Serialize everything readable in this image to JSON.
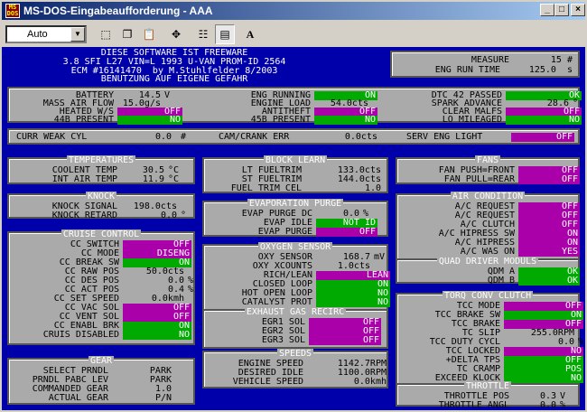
{
  "window": {
    "title": "MS-DOS-Eingabeaufforderung - AAA",
    "icon": "MS-DOS icon"
  },
  "toolbar": {
    "font_size": "Auto",
    "font_button": "A"
  },
  "header": {
    "lines": [
      "DIESE SOFTWARE IST FREEWARE",
      "3.8 SFI L27 VIN=L 1993 U-VAN PROM-ID 2564",
      "ECM #16141470  by M.Stuhlfelder 8/2003",
      "BENUTZUNG AUF EIGENE GEFAHR"
    ],
    "measure_label": "MEASURE",
    "measure_value": "15 #",
    "run_time_label": "ENG RUN TIME",
    "run_time_value": "125.0  s"
  },
  "status_top": {
    "left": [
      {
        "label": "BATTERY",
        "value": "14.5",
        "unit": "V"
      },
      {
        "label": "MASS AIR FLOW",
        "value": "15.0g/s"
      },
      {
        "label": "HEATED W/S",
        "state": "OFF",
        "color": "m"
      },
      {
        "label": "44B PRESENT",
        "state": "NO",
        "color": "g"
      }
    ],
    "mid": [
      {
        "label": "ENG RUNNING",
        "state": "ON",
        "color": "g"
      },
      {
        "label": "ENGINE LOAD",
        "value": "54.0cts"
      },
      {
        "label": "ANTITHEFT",
        "state": "OFF",
        "color": "m"
      },
      {
        "label": "45B PRESENT",
        "state": "NO",
        "color": "g"
      }
    ],
    "right": [
      {
        "label": "DTC 42 PASSED",
        "state": "OK",
        "color": "g"
      },
      {
        "label": "SPARK ADVANCE",
        "value": "28.6",
        "unit": "°"
      },
      {
        "label": "CLEAR MALFS",
        "state": "OFF",
        "color": "m"
      },
      {
        "label": "LO MILEAGED",
        "state": "NO",
        "color": "g"
      }
    ]
  },
  "status_bar": {
    "curr_label": "CURR WEAK CYL",
    "curr_value": "0.0",
    "curr_unit": "#",
    "cam_label": "CAM/CRANK ERR",
    "cam_value": "0.0cts",
    "serv_label": "SERV ENG LIGHT",
    "serv_state": "OFF"
  },
  "temperatures": {
    "title": "TEMPERATURES",
    "rows": [
      {
        "label": "COOLENT TEMP",
        "value": "30.5",
        "unit": "°C"
      },
      {
        "label": "INT AIR TEMP",
        "value": "11.9",
        "unit": "°C"
      }
    ]
  },
  "knock": {
    "title": "KNOCK",
    "rows": [
      {
        "label": "KNOCK SIGNAL",
        "value": "198.0cts"
      },
      {
        "label": "KNOCK RETARD",
        "value": "0.0",
        "unit": "°"
      }
    ]
  },
  "cruise": {
    "title": "CRUISE CONTROL",
    "rows": [
      {
        "label": "CC SWITCH",
        "state": "OFF",
        "color": "m"
      },
      {
        "label": "CC MODE",
        "state": "DISENG",
        "color": "m"
      },
      {
        "label": "CC BREAK SW",
        "state": "ON",
        "color": "g"
      },
      {
        "label": "CC RAW POS",
        "value": "50.0cts"
      },
      {
        "label": "CC DES POS",
        "value": "0.0",
        "unit": "%"
      },
      {
        "label": "CC ACT POS",
        "value": "0.4",
        "unit": "%"
      },
      {
        "label": "CC SET SPEED",
        "value": "0.0kmh"
      },
      {
        "label": "CC VAC SOL",
        "state": "OFF",
        "color": "m"
      },
      {
        "label": "CC VENT SOL",
        "state": "OFF",
        "color": "m"
      },
      {
        "label": "CC ENABL BRK",
        "state": "ON",
        "color": "g"
      },
      {
        "label": "CRUIS DISABLED",
        "state": "NO",
        "color": "g"
      }
    ]
  },
  "gear": {
    "title": "GEAR",
    "rows": [
      {
        "label": "SELECT PRNDL",
        "value": "PARK"
      },
      {
        "label": "PRNDL PABC LEV",
        "value": "PARK"
      },
      {
        "label": "COMMANDED GEAR",
        "value": "1.0"
      },
      {
        "label": "ACTUAL GEAR",
        "value": "P/N"
      }
    ]
  },
  "block_learn": {
    "title": "BLOCK LEARN",
    "rows": [
      {
        "label": "LT FUELTRIM",
        "value": "133.0cts"
      },
      {
        "label": "ST FUELTRIM",
        "value": "144.0cts"
      },
      {
        "label": "FUEL TRIM CEL",
        "value": "1.0"
      }
    ]
  },
  "evap": {
    "title": "EVAPORATION PURGE",
    "rows": [
      {
        "label": "EVAP PURGE DC",
        "value": "0.0",
        "unit": "%"
      },
      {
        "label": "EVAP IDLE",
        "state": "NOT ID",
        "color": "g"
      },
      {
        "label": "EVAP PURGE",
        "state": "OFF",
        "color": "m"
      }
    ]
  },
  "oxygen": {
    "title": "OXYGEN SENSOR",
    "rows": [
      {
        "label": "OXY SENSOR",
        "value": "168.7",
        "unit": "mV"
      },
      {
        "label": "OXY XCOUNTS",
        "value": "1.0cts"
      },
      {
        "label": "RICH/LEAN",
        "state": "LEAN",
        "color": "m"
      },
      {
        "label": "CLOSED LOOP",
        "state": "ON",
        "color": "g"
      },
      {
        "label": "HOT OPEN LOOP",
        "state": "NO",
        "color": "g"
      },
      {
        "label": "CATALYST PROT",
        "state": "NO",
        "color": "g"
      }
    ]
  },
  "egr": {
    "title": "EXHAUST GAS RECIRC",
    "rows": [
      {
        "label": "EGR1 SOL",
        "state": "OFF",
        "color": "m"
      },
      {
        "label": "EGR2 SOL",
        "state": "OFF",
        "color": "m"
      },
      {
        "label": "EGR3 SOL",
        "state": "OFF",
        "color": "m"
      }
    ]
  },
  "speeds": {
    "title": "SPEEDS",
    "rows": [
      {
        "label": "ENGINE SPEED",
        "value": "1142.7RPM"
      },
      {
        "label": "DESIRED IDLE",
        "value": "1100.0RPM"
      },
      {
        "label": "VEHICLE SPEED",
        "value": "0.0kmh"
      }
    ]
  },
  "fans": {
    "title": "FANS",
    "rows": [
      {
        "label": "FAN PUSH=FRONT",
        "state": "OFF",
        "color": "m"
      },
      {
        "label": "FAN PULL=REAR",
        "state": "OFF",
        "color": "m"
      }
    ]
  },
  "aircon": {
    "title": "AIR CONDITION",
    "rows": [
      {
        "label": "A/C REQUEST",
        "state": "OFF",
        "color": "m"
      },
      {
        "label": "A/C REQUEST",
        "state": "OFF",
        "color": "m"
      },
      {
        "label": "A/C CLUTCH",
        "state": "OFF",
        "color": "m"
      },
      {
        "label": "A/C HIPRESS SW",
        "state": "ON",
        "color": "m"
      },
      {
        "label": "A/C HIPRESS",
        "state": "ON",
        "color": "m"
      },
      {
        "label": "A/C WAS ON",
        "state": "YES",
        "color": "m"
      }
    ]
  },
  "quad": {
    "title": "QUAD DRIVER MODULS",
    "rows": [
      {
        "label": "QDM A",
        "state": "OK",
        "color": "g"
      },
      {
        "label": "QDM B",
        "state": "OK",
        "color": "g"
      }
    ]
  },
  "tcc": {
    "title": "TORQ CONV CLUTCH",
    "rows": [
      {
        "label": "TCC MODE",
        "state": "OFF",
        "color": "m"
      },
      {
        "label": "TCC BRAKE SW",
        "state": "ON",
        "color": "g"
      },
      {
        "label": "TCC BRAKE",
        "state": "OFF",
        "color": "m"
      },
      {
        "label": "TC SLIP",
        "value": "255.0RPM"
      },
      {
        "label": "TCC DUTY CYCL",
        "value": "0.0",
        "unit": "%"
      },
      {
        "label": "TCC LOCKED",
        "state": "NO",
        "color": "m"
      },
      {
        "label": "+DELTA TPS",
        "state": "OFF",
        "color": "g"
      },
      {
        "label": "TC CRAMP",
        "state": "POS",
        "color": "g"
      },
      {
        "label": "EXCEED KLOCK",
        "state": "NO",
        "color": "g"
      }
    ]
  },
  "throttle": {
    "title": "THROTTLE",
    "rows": [
      {
        "label": "THROTTLE POS",
        "value": "0.3",
        "unit": "V"
      },
      {
        "label": "THROTTLE ANGL",
        "value": "0.0",
        "unit": "%"
      }
    ]
  }
}
